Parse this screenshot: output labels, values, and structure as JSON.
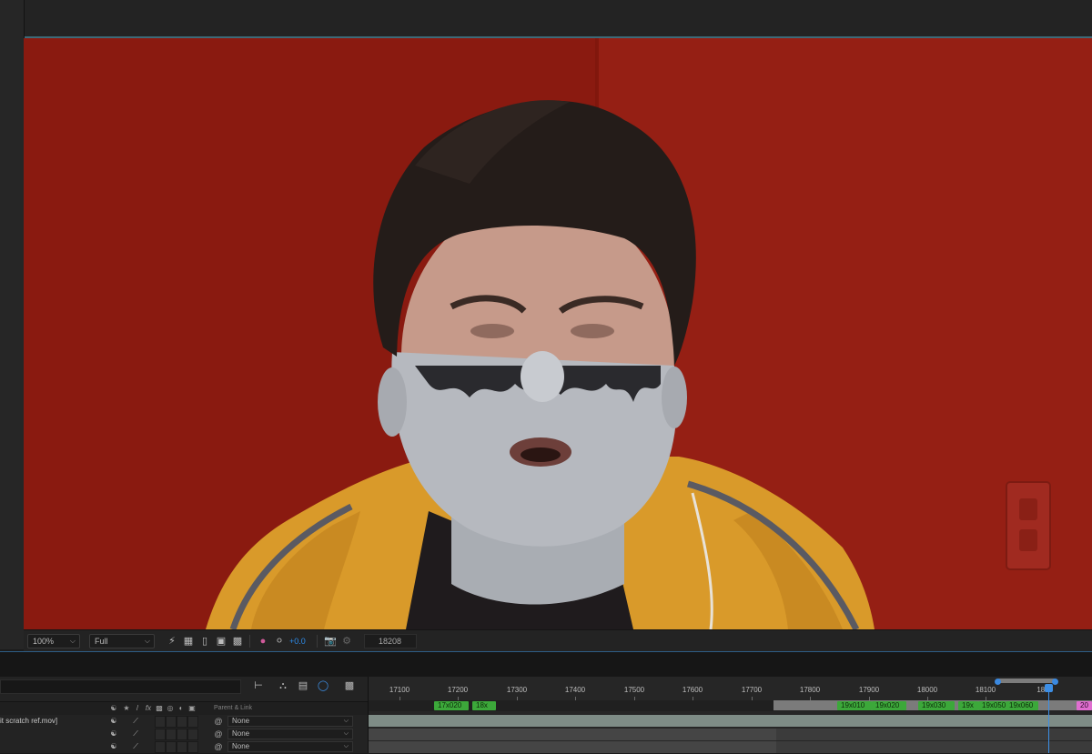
{
  "viewer": {
    "zoom": "100%",
    "resolution": "Full",
    "exposure": "+0.0",
    "current_frame": "18208",
    "footage_description": "man with silver face paint wearing yellow track jacket against red wall"
  },
  "timeline": {
    "search_placeholder": "",
    "columns": {
      "parent_link": "Parent & Link"
    },
    "layers": [
      {
        "name": "it scratch ref.mov]",
        "parent": "None"
      },
      {
        "name": "",
        "parent": "None"
      },
      {
        "name": "",
        "parent": "None"
      }
    ],
    "ruler": [
      "17100",
      "17200",
      "17300",
      "17400",
      "17500",
      "17600",
      "17700",
      "17800",
      "17900",
      "18000",
      "18100",
      "182"
    ],
    "markers": [
      {
        "label": "17x020",
        "color": "green"
      },
      {
        "label": "18x",
        "color": "green"
      },
      {
        "label": "19x010",
        "color": "green"
      },
      {
        "label": "19x020",
        "color": "green"
      },
      {
        "label": "19x030",
        "color": "green"
      },
      {
        "label": "19x",
        "color": "green"
      },
      {
        "label": "19x050",
        "color": "green"
      },
      {
        "label": "19x060",
        "color": "green"
      },
      {
        "label": "20",
        "color": "pink"
      }
    ]
  },
  "colors": {
    "accent_blue": "#3d8fe6",
    "marker_green": "#3ca83a",
    "marker_pink": "#e06ed0",
    "wall_red": "#8f1c12"
  }
}
